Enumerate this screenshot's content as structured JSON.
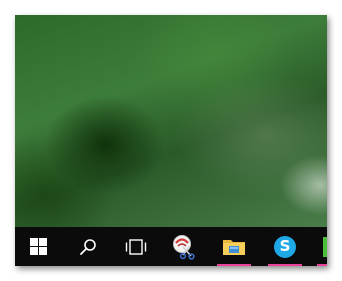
{
  "taskbar": {
    "accent_color": "#e8429a",
    "items": [
      {
        "icon": "windows-logo-icon",
        "active": false
      },
      {
        "icon": "search-icon",
        "active": false
      },
      {
        "icon": "task-view-icon",
        "active": false
      },
      {
        "icon": "snipping-tool-icon",
        "active": false
      },
      {
        "icon": "file-explorer-icon",
        "active": true
      },
      {
        "icon": "skype-icon",
        "active": true,
        "glyph": "S"
      },
      {
        "icon": "app-icon",
        "active": true
      }
    ]
  }
}
